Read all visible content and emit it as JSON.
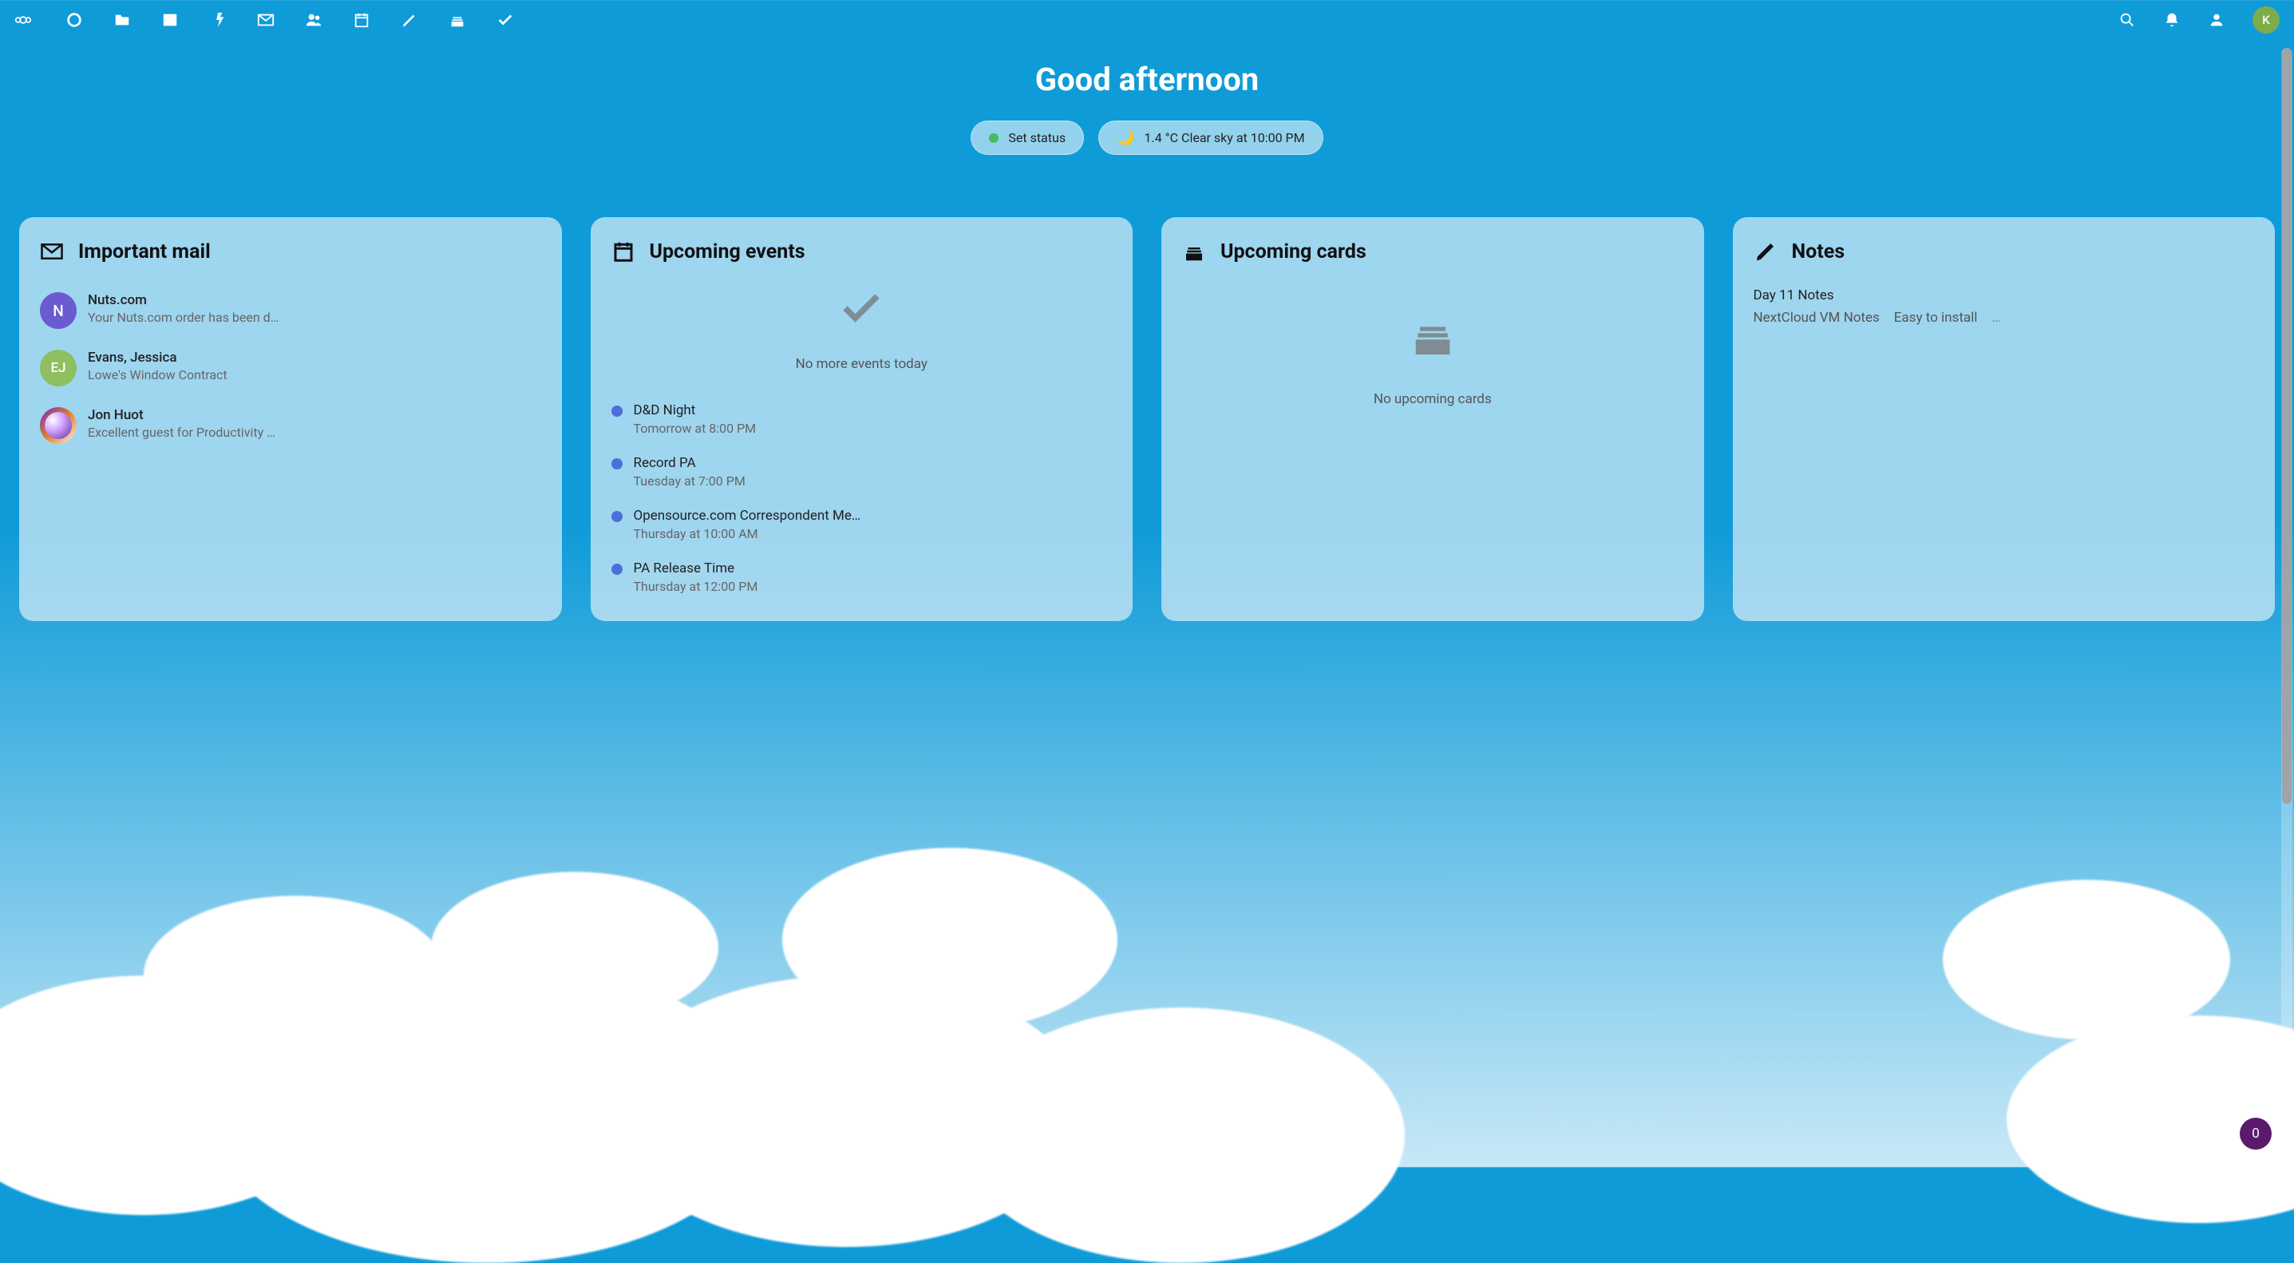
{
  "greeting": "Good afternoon",
  "status_pill": {
    "label": "Set status"
  },
  "weather_pill": {
    "text": "1.4 °C Clear sky at 10:00 PM"
  },
  "avatar_initial": "K",
  "float_badge": "0",
  "widgets": {
    "mail": {
      "title": "Important mail",
      "items": [
        {
          "initial": "N",
          "from": "Nuts.com",
          "subject": "Your Nuts.com order has been d…"
        },
        {
          "initial": "EJ",
          "from": "Evans, Jessica",
          "subject": "Lowe's Window Contract"
        },
        {
          "initial": "",
          "from": "Jon Huot",
          "subject": "Excellent guest for Productivity …"
        }
      ]
    },
    "events": {
      "title": "Upcoming events",
      "empty_today": "No more events today",
      "items": [
        {
          "title": "D&D Night",
          "time": "Tomorrow at 8:00 PM"
        },
        {
          "title": "Record PA",
          "time": "Tuesday at 7:00 PM"
        },
        {
          "title": "Opensource.com Correspondent Me…",
          "time": "Thursday at 10:00 AM"
        },
        {
          "title": "PA Release Time",
          "time": "Thursday at 12:00 PM"
        }
      ]
    },
    "cards": {
      "title": "Upcoming cards",
      "empty": "No upcoming cards"
    },
    "notes": {
      "title": "Notes",
      "items": [
        {
          "line": "Day 11 Notes"
        }
      ],
      "second_row": {
        "a": "NextCloud VM Notes",
        "b": "Easy to install",
        "c": "…"
      }
    }
  }
}
